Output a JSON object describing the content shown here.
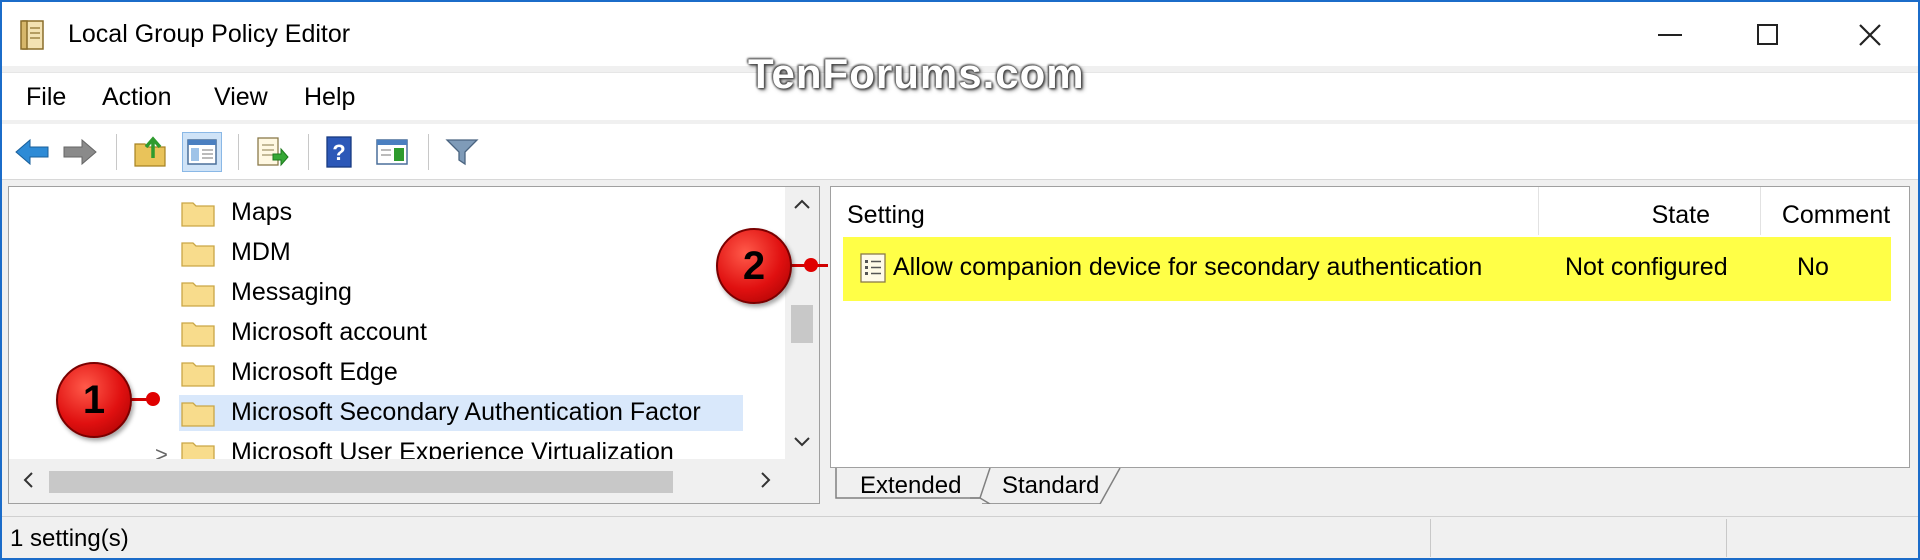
{
  "window": {
    "title": "Local Group Policy Editor",
    "watermark": "TenForums.com",
    "controls": {
      "minimize": "—",
      "maximize": "☐",
      "close": "✕"
    }
  },
  "menu": [
    "File",
    "Action",
    "View",
    "Help"
  ],
  "toolbar": {
    "icons": [
      "back-arrow-icon",
      "forward-arrow-icon",
      "up-folder-icon",
      "show-hide-tree-icon",
      "export-list-icon",
      "help-icon",
      "properties-icon",
      "filter-icon"
    ]
  },
  "tree": {
    "items": [
      {
        "label": "Maps"
      },
      {
        "label": "MDM"
      },
      {
        "label": "Messaging"
      },
      {
        "label": "Microsoft account"
      },
      {
        "label": "Microsoft Edge"
      },
      {
        "label": "Microsoft Secondary Authentication Factor",
        "selected": true
      },
      {
        "label": "Microsoft User Experience Virtualization",
        "expander": ">"
      }
    ]
  },
  "details": {
    "columns": {
      "setting": "Setting",
      "state": "State",
      "comment": "Comment"
    },
    "rows": [
      {
        "setting": "Allow companion device for secondary authentication",
        "state": "Not configured",
        "comment": "No"
      }
    ]
  },
  "tabs": {
    "extended": "Extended",
    "standard": "Standard"
  },
  "status": {
    "text": "1 setting(s)"
  },
  "callouts": {
    "one": "1",
    "two": "2"
  },
  "colors": {
    "highlight": "#ffff47",
    "selection": "#d9e8fb",
    "callout": "#e01010",
    "accent_border": "#1b6cc9"
  }
}
